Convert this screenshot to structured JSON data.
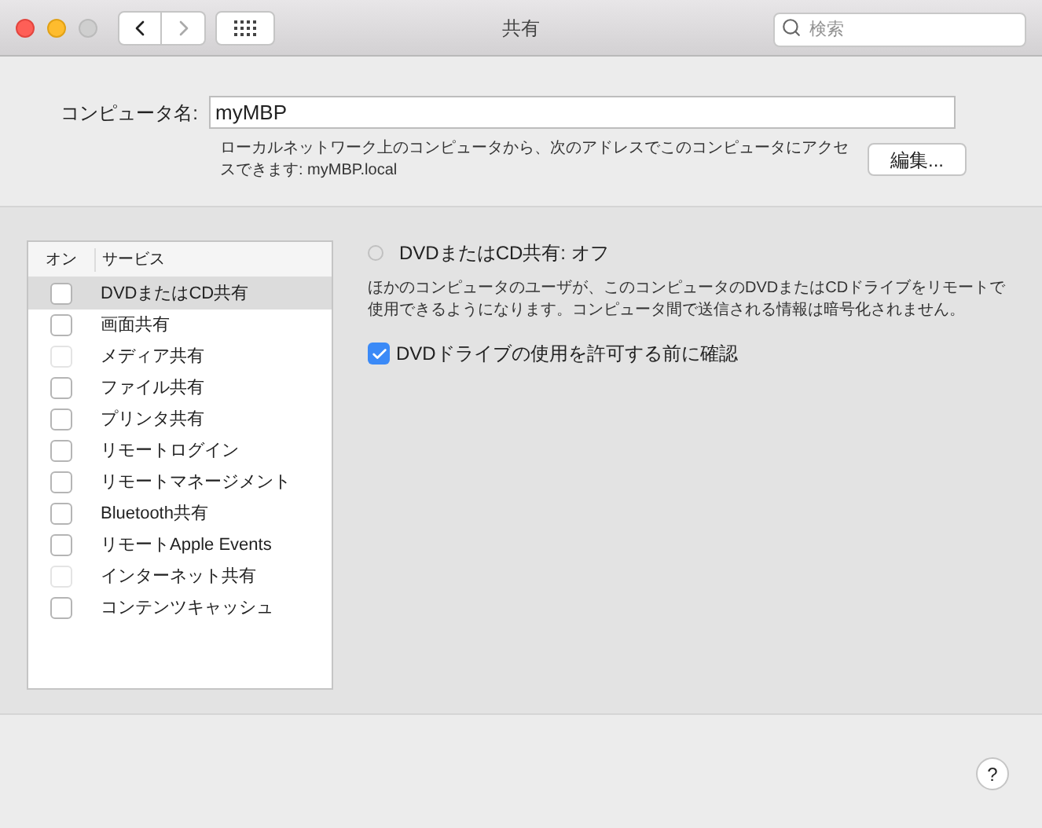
{
  "window": {
    "title": "共有"
  },
  "search": {
    "placeholder": "検索"
  },
  "computer_name": {
    "label": "コンピュータ名:",
    "value": "myMBP",
    "note": "ローカルネットワーク上のコンピュータから、次のアドレスでこのコンピュータにアクセスできます: myMBP.local",
    "edit_button": "編集..."
  },
  "services": {
    "columns": [
      "オン",
      "サービス"
    ],
    "rows": [
      {
        "name": "DVDまたはCD共有",
        "checked": false,
        "disabled": false,
        "selected": true
      },
      {
        "name": "画面共有",
        "checked": false,
        "disabled": false,
        "selected": false
      },
      {
        "name": "メディア共有",
        "checked": false,
        "disabled": true,
        "selected": false
      },
      {
        "name": "ファイル共有",
        "checked": false,
        "disabled": false,
        "selected": false
      },
      {
        "name": "プリンタ共有",
        "checked": false,
        "disabled": false,
        "selected": false
      },
      {
        "name": "リモートログイン",
        "checked": false,
        "disabled": false,
        "selected": false
      },
      {
        "name": "リモートマネージメント",
        "checked": false,
        "disabled": false,
        "selected": false
      },
      {
        "name": "Bluetooth共有",
        "checked": false,
        "disabled": false,
        "selected": false
      },
      {
        "name": "リモートApple Events",
        "checked": false,
        "disabled": false,
        "selected": false
      },
      {
        "name": "インターネット共有",
        "checked": false,
        "disabled": true,
        "selected": false
      },
      {
        "name": "コンテンツキャッシュ",
        "checked": false,
        "disabled": false,
        "selected": false
      }
    ]
  },
  "detail": {
    "status": "DVDまたはCD共有: オフ",
    "on": false,
    "description": "ほかのコンピュータのユーザが、このコンピュータのDVDまたはCDドライブをリモートで使用できるようになります。コンピュータ間で送信される情報は暗号化されません。",
    "option": {
      "label": "DVDドライブの使用を許可する前に確認",
      "checked": true
    }
  },
  "help_button": "?"
}
